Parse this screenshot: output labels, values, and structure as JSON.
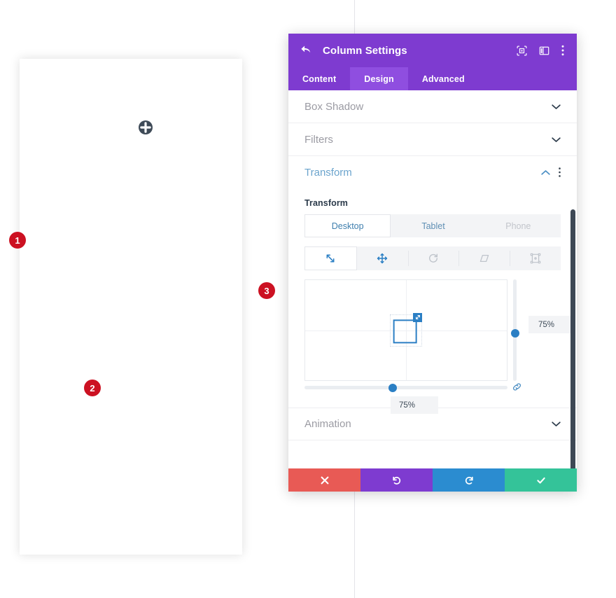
{
  "builder": {
    "add_button_icon": "plus-icon",
    "guide_line": "vertical-guide"
  },
  "modal": {
    "title": "Column Settings",
    "back_icon": "back-arrow-icon",
    "header_icons": [
      {
        "name": "focus-preview-icon"
      },
      {
        "name": "split-view-icon"
      },
      {
        "name": "more-options-icon"
      }
    ],
    "tabs": [
      {
        "label": "Content",
        "active": false
      },
      {
        "label": "Design",
        "active": true
      },
      {
        "label": "Advanced",
        "active": false
      }
    ],
    "sections": [
      {
        "label": "Box Shadow",
        "open": false
      },
      {
        "label": "Filters",
        "open": false
      },
      {
        "label": "Transform",
        "open": true
      },
      {
        "label": "Animation",
        "open": false
      }
    ],
    "transform": {
      "field_label": "Transform",
      "devices": [
        {
          "label": "Desktop",
          "state": "active"
        },
        {
          "label": "Tablet",
          "state": "normal"
        },
        {
          "label": "Phone",
          "state": "disabled"
        }
      ],
      "tools": [
        {
          "name": "scale-tool",
          "icon": "diagonal-resize-icon",
          "active": true
        },
        {
          "name": "move-tool",
          "icon": "move-arrows-icon",
          "active": false
        },
        {
          "name": "rotate-tool",
          "icon": "rotate-icon",
          "active": false
        },
        {
          "name": "skew-tool",
          "icon": "skew-parallelogram-icon",
          "active": false
        },
        {
          "name": "origin-tool",
          "icon": "transform-origin-icon",
          "active": false
        }
      ],
      "scale_x_value": "75%",
      "scale_y_value": "75%",
      "link_icon": "link-chain-icon"
    },
    "badges": [
      {
        "number": "1"
      },
      {
        "number": "2"
      },
      {
        "number": "3"
      }
    ],
    "footer_buttons": [
      {
        "name": "cancel-button",
        "icon": "close-x-icon",
        "color": "#e85a55"
      },
      {
        "name": "undo-button",
        "icon": "undo-arrow-icon",
        "color": "#7e3bd0"
      },
      {
        "name": "redo-button",
        "icon": "redo-arrow-icon",
        "color": "#2b8cd0"
      },
      {
        "name": "save-button",
        "icon": "checkmark-icon",
        "color": "#34c399"
      }
    ]
  },
  "colors": {
    "purple": "#7e3bd0",
    "purple_light": "#8f4ee0",
    "blue": "#2b7fc4",
    "red_badge": "#cc1122"
  }
}
